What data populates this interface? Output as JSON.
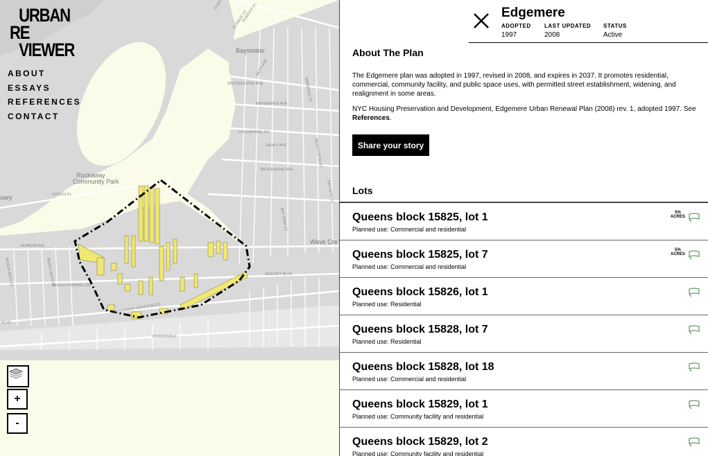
{
  "logo": {
    "line1": "URBAN",
    "line2": "RE",
    "line3": "VIEWER"
  },
  "nav": [
    "ABOUT",
    "ESSAYS",
    "REFERENCES",
    "CONTACT"
  ],
  "map": {
    "labels": [
      "Bayswater",
      "Rockaway",
      "Community Park",
      "Wave Cre",
      "uary"
    ],
    "streets": [
      "POINT BREEZE",
      "DUNBAR ST",
      "EGMONT PL",
      "MOTT AVE",
      "ALMEDA AVE",
      "BEACH CHANNEL DR",
      "ROCKAWAY BEACH BLVD",
      "BOARDWALK",
      "SEAGIRT BLVD",
      "BAYSWATER AVE",
      "HEALY AVE",
      "BESSEMUND AVE",
      "CONCH PL",
      "BAY 32ND ST",
      "BEACH 38TH ST",
      "COLDSPRING RD",
      "BLVD",
      "WESTBOURNE AVE",
      "BEACH 24TH ST",
      "BAY 24TH ST",
      "NAMEOKE ST",
      "BEACH 44TH ST"
    ],
    "zoom_in": "+",
    "zoom_out": "-",
    "layers_icon": "layers-icon"
  },
  "plan": {
    "name": "Edgemere",
    "adopted_label": "ADOPTED",
    "adopted": "1997",
    "updated_label": "LAST UPDATED",
    "updated": "2008",
    "status_label": "STATUS",
    "status": "Active",
    "about_heading": "About The Plan",
    "about_text": "The Edgemere plan was adopted in 1997, revised in 2008, and expires in 2037. It promotes residential, commercial, community facility, and public space uses, with permitted street establishment, widening, and realignment in some areas.",
    "source_text": "NYC Housing Preservation and Development, Edgemere Urban Renewal Plan (2008) rev. 1, adopted 1997. See ",
    "source_link": "References",
    "source_end": ".",
    "share_label": "Share your story",
    "lots_heading": "Lots"
  },
  "lots": [
    {
      "name": "Queens block 15825, lot 1",
      "use": "Planned use: Commercial and residential",
      "acres_pct": "5%",
      "acres_label": "ACRES"
    },
    {
      "name": "Queens block 15825, lot 7",
      "use": "Planned use: Commercial and residential",
      "acres_pct": "5%",
      "acres_label": "ACRES"
    },
    {
      "name": "Queens block 15826, lot 1",
      "use": "Planned use: Residential"
    },
    {
      "name": "Queens block 15828, lot 7",
      "use": "Planned use: Residential"
    },
    {
      "name": "Queens block 15828, lot 18",
      "use": "Planned use: Commercial and residential"
    },
    {
      "name": "Queens block 15829, lot 1",
      "use": "Planned use: Community facility and residential"
    },
    {
      "name": "Queens block 15829, lot 2",
      "use": "Planned use: Community facility and residential"
    }
  ],
  "colors": {
    "map_bg": "#fbfbea",
    "land": "#d9d9d9",
    "street": "#ffffff",
    "lot_fill": "#f1e873",
    "icon_green": "#6a9a6a"
  }
}
